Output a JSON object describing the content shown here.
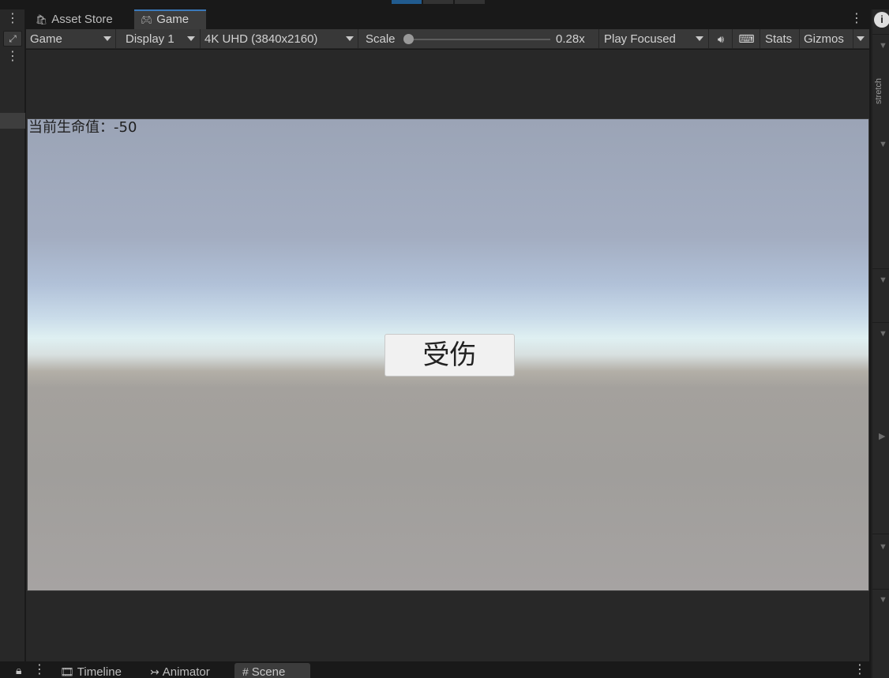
{
  "topbar": {
    "accent": "#215b8f"
  },
  "tabs": [
    {
      "label": "Asset Store",
      "icon": "shopping-bag-icon",
      "active": false
    },
    {
      "label": "Game",
      "icon": "gamepad-icon",
      "active": true
    }
  ],
  "toolbar": {
    "view_mode": "Game",
    "display": "Display 1",
    "resolution": "4K UHD (3840x2160)",
    "scale_label": "Scale",
    "scale_value": "0.28x",
    "play_mode": "Play Focused",
    "stats": "Stats",
    "gizmos": "Gizmos"
  },
  "game": {
    "health_text": "当前生命值：-50",
    "damage_button": "受伤"
  },
  "right_panel": {
    "vertical_label": "stretch"
  },
  "bottom_tabs": [
    {
      "label": "Timeline",
      "icon": "film-icon",
      "active": false
    },
    {
      "label": "Animator",
      "icon": "animator-icon",
      "active": false
    },
    {
      "label": "Scene",
      "icon": "grid-icon",
      "active": true
    }
  ]
}
